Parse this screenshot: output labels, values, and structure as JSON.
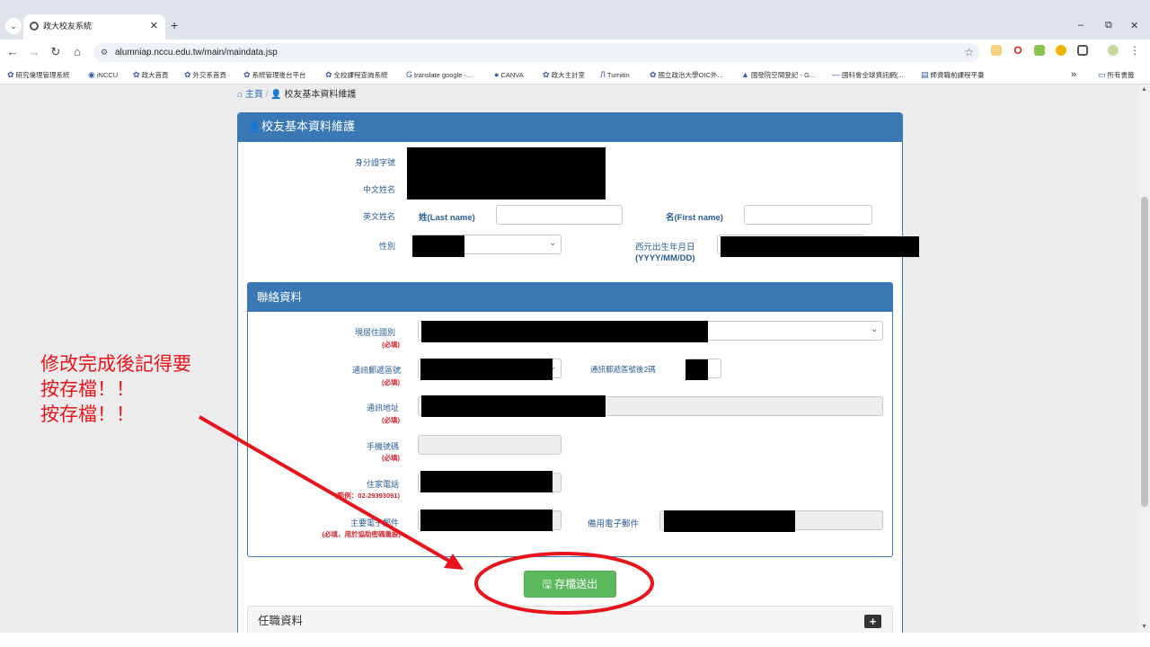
{
  "browser": {
    "tab_title": "政大校友系統",
    "url": "alumniap.nccu.edu.tw/main/maindata.jsp",
    "bookmarks": [
      "研究倫理管理系統",
      "iNCCU",
      "政大首頁",
      "外交系首頁",
      "系統管理後台平台",
      "全校課程查詢系統",
      "translate google -...",
      "CANVA",
      "政大主計室",
      "Turnitin",
      "國立政治大學OIC外...",
      "國發院空間登記 - G...",
      "國科會全球資訊網(...",
      "師資職前課程平臺"
    ],
    "bookmarks_overflow": "»",
    "all_bookmarks": "所有書籤"
  },
  "breadcrumb": {
    "home": "主頁",
    "sep": "/",
    "current": "校友基本資料維護"
  },
  "card": {
    "title": "校友基本資料維護"
  },
  "basic": {
    "id_label": "身分證字號",
    "cname_label": "中文姓名",
    "ename_label": "英文姓名",
    "last_name_label": "姓(Last name)",
    "first_name_label": "名(First name)",
    "gender_label": "性別",
    "birth_label": "西元出生年月日",
    "birth_format": "(YYYY/MM/DD)"
  },
  "contact": {
    "title": "聯絡資料",
    "country_label": "現居住國別",
    "zip_label": "通訊郵遞區號",
    "zip2_label": "通訊郵遞區號後2碼",
    "address_label": "通訊地址",
    "mobile_label": "手機號碼",
    "home_phone_label": "住家電話",
    "home_phone_hint": "(範例：02-29393091)",
    "email_label": "主要電子郵件",
    "email_hint": "(必填，用於協助密碼重設)",
    "alt_email_label": "備用電子郵件",
    "required": "(必填)"
  },
  "save_button": "存檔送出",
  "employment": {
    "title": "任職資料"
  },
  "annotation": {
    "note": "修改完成後記得要\n按存檔！！\n按存檔！！",
    "color": "#e8131b"
  },
  "colors": {
    "primary": "#3a78b5",
    "success": "#5cb85c",
    "annotation": "#e8131b"
  }
}
